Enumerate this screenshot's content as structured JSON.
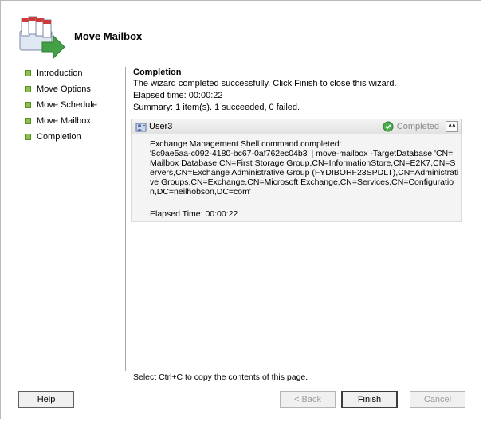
{
  "header": {
    "title": "Move Mailbox"
  },
  "nav": {
    "items": [
      {
        "label": "Introduction"
      },
      {
        "label": "Move Options"
      },
      {
        "label": "Move Schedule"
      },
      {
        "label": "Move Mailbox"
      },
      {
        "label": "Completion"
      }
    ]
  },
  "content": {
    "title": "Completion",
    "message": "The wizard completed successfully. Click Finish to close this wizard.",
    "elapsed": "Elapsed time: 00:00:22",
    "summary": "Summary: 1 item(s). 1 succeeded, 0 failed."
  },
  "task": {
    "name": "User3",
    "status": "Completed",
    "collapse_glyph": "˄˄",
    "command": "Exchange Management Shell command completed:\n'8c9ae5aa-c092-4180-bc67-0af762ec04b3' | move-mailbox -TargetDatabase 'CN=Mailbox Database,CN=First Storage Group,CN=InformationStore,CN=E2K7,CN=Servers,CN=Exchange Administrative Group (FYDIBOHF23SPDLT),CN=Administrative Groups,CN=Exchange,CN=Microsoft Exchange,CN=Services,CN=Configuration,DC=neilhobson,DC=com'",
    "elapsed": "Elapsed Time: 00:00:22"
  },
  "footer": {
    "copy_hint": "Select Ctrl+C to copy the contents of this page.",
    "help": "Help",
    "back": "< Back",
    "finish": "Finish",
    "cancel": "Cancel"
  },
  "colors": {
    "nav_bullet": "#8bc34a",
    "status_check": "#4caf50",
    "disabled_text": "#9c9c9c"
  },
  "icons": {
    "wizard": "mailbox-move-icon",
    "user": "user-icon",
    "status": "check-circle-icon",
    "collapse": "double-chevron-up-icon"
  }
}
